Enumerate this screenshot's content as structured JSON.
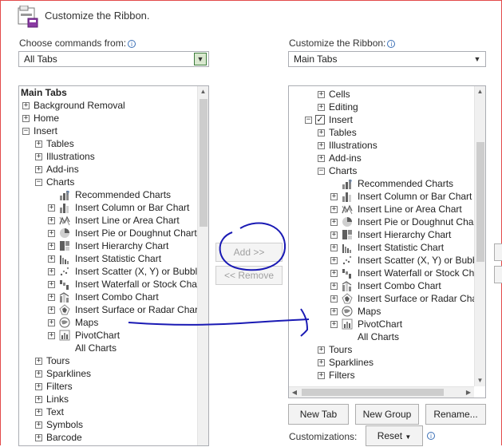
{
  "dialog": {
    "title": "Customize the Ribbon."
  },
  "left": {
    "label": "Choose commands from:",
    "combo_value": "All Tabs",
    "header": "Main Tabs",
    "items": [
      {
        "text": "Background Removal",
        "level": 0,
        "expander": "+"
      },
      {
        "text": "Home",
        "level": 0,
        "expander": "+"
      },
      {
        "text": "Insert",
        "level": 0,
        "expander": "-"
      },
      {
        "text": "Tables",
        "level": 1,
        "expander": "+"
      },
      {
        "text": "Illustrations",
        "level": 1,
        "expander": "+"
      },
      {
        "text": "Add-ins",
        "level": 1,
        "expander": "+"
      },
      {
        "text": "Charts",
        "level": 1,
        "expander": "-"
      },
      {
        "text": "Recommended Charts",
        "level": 2,
        "expander": "",
        "icon": "recommended-charts-icon"
      },
      {
        "text": "Insert Column or Bar Chart",
        "level": 2,
        "expander": "+",
        "icon": "column-chart-icon"
      },
      {
        "text": "Insert Line or Area Chart",
        "level": 2,
        "expander": "+",
        "icon": "line-chart-icon"
      },
      {
        "text": "Insert Pie or Doughnut Chart",
        "level": 2,
        "expander": "+",
        "icon": "pie-chart-icon"
      },
      {
        "text": "Insert Hierarchy Chart",
        "level": 2,
        "expander": "+",
        "icon": "hierarchy-chart-icon"
      },
      {
        "text": "Insert Statistic Chart",
        "level": 2,
        "expander": "+",
        "icon": "statistic-chart-icon"
      },
      {
        "text": "Insert Scatter (X, Y) or Bubble Chart",
        "level": 2,
        "expander": "+",
        "icon": "scatter-chart-icon"
      },
      {
        "text": "Insert Waterfall or Stock Chart",
        "level": 2,
        "expander": "+",
        "icon": "waterfall-chart-icon"
      },
      {
        "text": "Insert Combo Chart",
        "level": 2,
        "expander": "+",
        "icon": "combo-chart-icon"
      },
      {
        "text": "Insert Surface or Radar Chart",
        "level": 2,
        "expander": "+",
        "icon": "radar-chart-icon"
      },
      {
        "text": "Maps",
        "level": 2,
        "expander": "+",
        "icon": "maps-icon"
      },
      {
        "text": "PivotChart",
        "level": 2,
        "expander": "+",
        "icon": "pivotchart-icon"
      },
      {
        "text": "All Charts",
        "level": 2,
        "expander": ""
      },
      {
        "text": "Tours",
        "level": 1,
        "expander": "+"
      },
      {
        "text": "Sparklines",
        "level": 1,
        "expander": "+"
      },
      {
        "text": "Filters",
        "level": 1,
        "expander": "+"
      },
      {
        "text": "Links",
        "level": 1,
        "expander": "+"
      },
      {
        "text": "Text",
        "level": 1,
        "expander": "+"
      },
      {
        "text": "Symbols",
        "level": 1,
        "expander": "+"
      },
      {
        "text": "Barcode",
        "level": 1,
        "expander": "+"
      }
    ]
  },
  "middle": {
    "add_label": "Add >>",
    "remove_label": "<< Remove"
  },
  "right": {
    "label": "Customize the Ribbon:",
    "combo_value": "Main Tabs",
    "items": [
      {
        "text": "Cells",
        "level": 1,
        "expander": "+"
      },
      {
        "text": "Editing",
        "level": 1,
        "expander": "+"
      },
      {
        "text": "Insert",
        "level": 0,
        "expander": "-",
        "checked": true
      },
      {
        "text": "Tables",
        "level": 1,
        "expander": "+"
      },
      {
        "text": "Illustrations",
        "level": 1,
        "expander": "+"
      },
      {
        "text": "Add-ins",
        "level": 1,
        "expander": "+"
      },
      {
        "text": "Charts",
        "level": 1,
        "expander": "-"
      },
      {
        "text": "Recommended Charts",
        "level": 2,
        "expander": "",
        "icon": "recommended-charts-icon"
      },
      {
        "text": "Insert Column or Bar Chart",
        "level": 2,
        "expander": "+",
        "icon": "column-chart-icon"
      },
      {
        "text": "Insert Line or Area Chart",
        "level": 2,
        "expander": "+",
        "icon": "line-chart-icon"
      },
      {
        "text": "Insert Pie or Doughnut Chart",
        "level": 2,
        "expander": "+",
        "icon": "pie-chart-icon"
      },
      {
        "text": "Insert Hierarchy Chart",
        "level": 2,
        "expander": "+",
        "icon": "hierarchy-chart-icon"
      },
      {
        "text": "Insert Statistic Chart",
        "level": 2,
        "expander": "+",
        "icon": "statistic-chart-icon"
      },
      {
        "text": "Insert Scatter (X, Y) or Bubble Chart",
        "level": 2,
        "expander": "+",
        "icon": "scatter-chart-icon"
      },
      {
        "text": "Insert Waterfall or Stock Chart",
        "level": 2,
        "expander": "+",
        "icon": "waterfall-chart-icon"
      },
      {
        "text": "Insert Combo Chart",
        "level": 2,
        "expander": "+",
        "icon": "combo-chart-icon"
      },
      {
        "text": "Insert Surface or Radar Chart",
        "level": 2,
        "expander": "+",
        "icon": "radar-chart-icon"
      },
      {
        "text": "Maps",
        "level": 2,
        "expander": "+",
        "icon": "maps-icon"
      },
      {
        "text": "PivotChart",
        "level": 2,
        "expander": "+",
        "icon": "pivotchart-icon"
      },
      {
        "text": "All Charts",
        "level": 2,
        "expander": ""
      },
      {
        "text": "Tours",
        "level": 1,
        "expander": "+"
      },
      {
        "text": "Sparklines",
        "level": 1,
        "expander": "+"
      },
      {
        "text": "Filters",
        "level": 1,
        "expander": "+"
      }
    ],
    "new_tab_label": "New Tab",
    "new_group_label": "New Group",
    "rename_label": "Rename...",
    "customizations_label": "Customizations:",
    "reset_label": "Reset"
  },
  "colors": {
    "annotation_ink": "#1a1ab4",
    "window_border": "#e24a4a",
    "selected_green": "#3c7c3c"
  }
}
